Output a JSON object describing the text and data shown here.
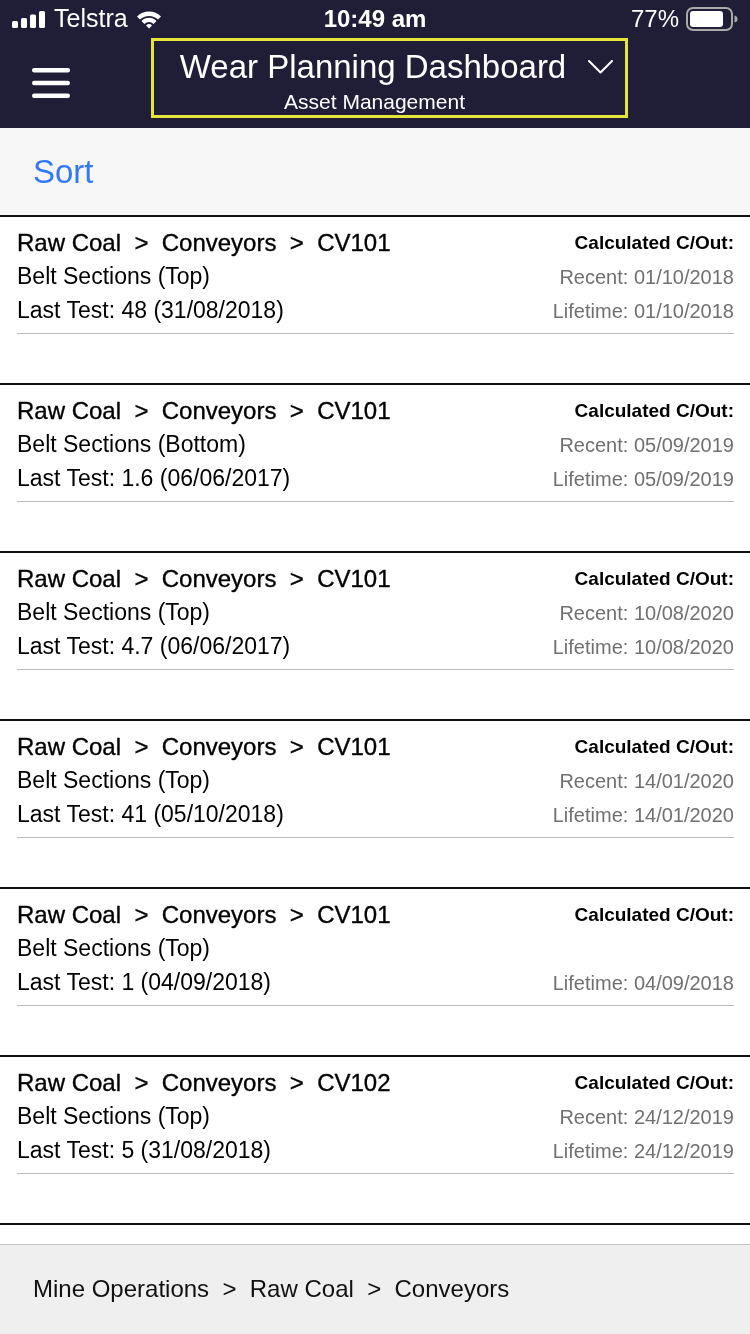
{
  "status_bar": {
    "carrier": "Telstra",
    "time": "10:49 am",
    "battery": "77%"
  },
  "header": {
    "title": "Wear Planning Dashboard",
    "subtitle": "Asset Management",
    "highlighted": true
  },
  "toolbar": {
    "sort_button": "Sort"
  },
  "assets": [
    {
      "path": "Raw Coal  >  Conveyors  >  CV101",
      "component": "Belt Sections (Top)",
      "last_test": "Last Test: 48 (31/08/2018)",
      "changeout_label": "Calculated C/Out:",
      "recent": "Recent: 01/10/2018",
      "lifetime": "Lifetime: 01/10/2018"
    },
    {
      "path": "Raw Coal  >  Conveyors  >  CV101",
      "component": "Belt Sections (Bottom)",
      "last_test": "Last Test: 1.6 (06/06/2017)",
      "changeout_label": "Calculated C/Out:",
      "recent": "Recent: 05/09/2019",
      "lifetime": "Lifetime: 05/09/2019"
    },
    {
      "path": "Raw Coal  >  Conveyors  >  CV101",
      "component": "Belt Sections (Top)",
      "last_test": "Last Test: 4.7 (06/06/2017)",
      "changeout_label": "Calculated C/Out:",
      "recent": "Recent: 10/08/2020",
      "lifetime": "Lifetime: 10/08/2020"
    },
    {
      "path": "Raw Coal  >  Conveyors  >  CV101",
      "component": "Belt Sections (Top)",
      "last_test": "Last Test: 41 (05/10/2018)",
      "changeout_label": "Calculated C/Out:",
      "recent": "Recent: 14/01/2020",
      "lifetime": "Lifetime: 14/01/2020"
    },
    {
      "path": "Raw Coal  >  Conveyors  >  CV101",
      "component": "Belt Sections (Top)",
      "last_test": "Last Test: 1 (04/09/2018)",
      "changeout_label": "Calculated C/Out:",
      "lifetime": "Lifetime: 04/09/2018"
    },
    {
      "path": "Raw Coal  >  Conveyors  >  CV102",
      "component": "Belt Sections (Top)",
      "last_test": "Last Test: 5 (31/08/2018)",
      "changeout_label": "Calculated C/Out:",
      "recent": "Recent: 24/12/2019",
      "lifetime": "Lifetime: 24/12/2019"
    }
  ],
  "footer": {
    "breadcrumb": "Mine Operations  >  Raw Coal  >  Conveyors"
  }
}
